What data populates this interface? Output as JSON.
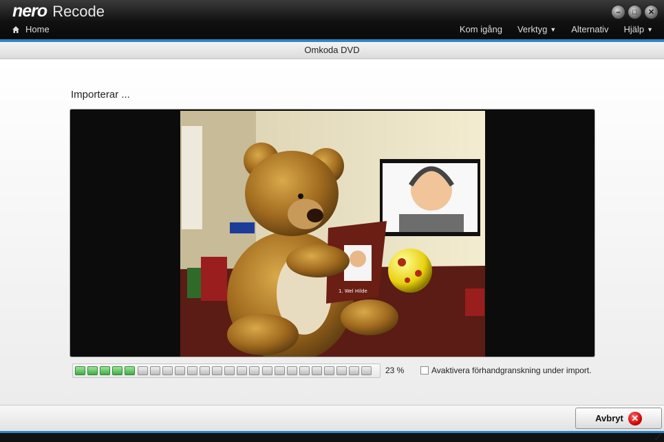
{
  "app": {
    "logo": "nero",
    "title": "Recode"
  },
  "nav": {
    "home_label": "Home"
  },
  "menu": [
    {
      "label": "Kom igång",
      "dropdown": false
    },
    {
      "label": "Verktyg",
      "dropdown": true
    },
    {
      "label": "Alternativ",
      "dropdown": false
    },
    {
      "label": "Hjälp",
      "dropdown": true
    }
  ],
  "window_controls": [
    "minimize-icon",
    "maximize-icon",
    "close-icon"
  ],
  "header": {
    "title": "Omkoda DVD"
  },
  "main": {
    "status_label": "Importerar ...",
    "progress": {
      "fraction": 0.23,
      "text": "23 %",
      "segments_total": 24,
      "segments_done": 5
    },
    "preview_checkbox": {
      "label": "Avaktivera förhandgranskning under import.",
      "checked": false
    },
    "photo_caption": "1. Wel Hilde"
  },
  "footer": {
    "cancel_label": "Avbryt"
  },
  "colors": {
    "accent": "#2a86c8",
    "progress_green": "#3fab45",
    "cancel_red": "#cc0000"
  }
}
